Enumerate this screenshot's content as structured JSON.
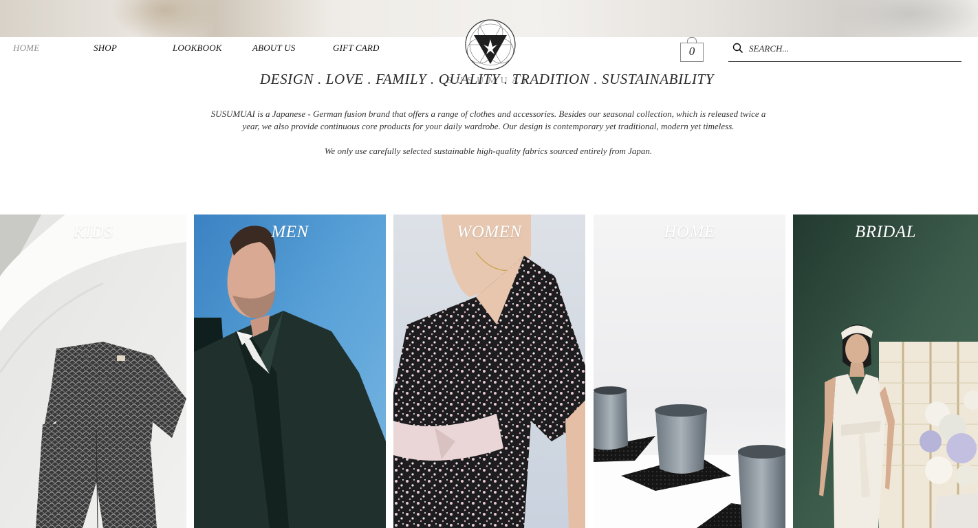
{
  "nav": {
    "items": [
      {
        "label": "HOME",
        "active": true
      },
      {
        "label": "SHOP"
      },
      {
        "label": "LOOKBOOK"
      },
      {
        "label": "ABOUT US"
      },
      {
        "label": "GIFT CARD"
      }
    ]
  },
  "cart": {
    "count": "0"
  },
  "search": {
    "placeholder": "SEARCH..."
  },
  "brand": {
    "ghost": "SUSUMUAI"
  },
  "tagline": "DESIGN . LOVE . FAMILY . QUALITY . TRADITION . SUSTAINABILITY",
  "intro": {
    "paragraph1": "SUSUMUAI is a Japanese - German fusion brand that offers a range of clothes and accessories. Besides our seasonal collection, which is released twice a year, we also provide continuous core products for your daily wardrobe. Our design is contemporary yet traditional, modern yet timeless.",
    "paragraph2": "We only use carefully selected sustainable high-quality fabrics sourced entirely from Japan."
  },
  "categories": [
    {
      "label": "KIDS"
    },
    {
      "label": "MEN"
    },
    {
      "label": "WOMEN"
    },
    {
      "label": "HOME"
    },
    {
      "label": "BRIDAL"
    }
  ],
  "colors": {
    "nav_active": "#8f8f8f",
    "text": "#2b2b2b",
    "men_bg": "#4d97cf",
    "bridal_bg": "#2f4a3d"
  }
}
